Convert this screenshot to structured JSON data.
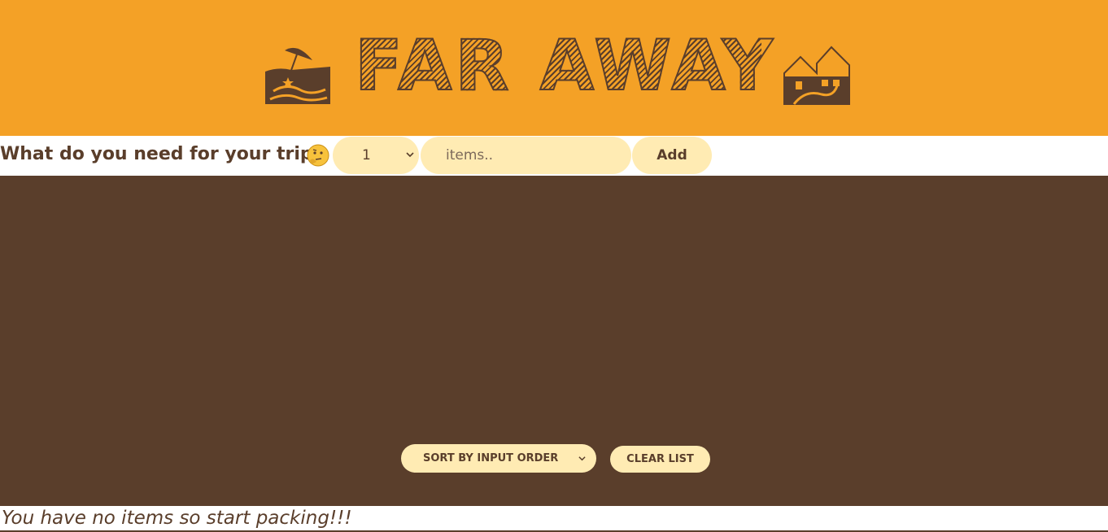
{
  "header": {
    "title": "FAR AWAY",
    "left_icon": "beach-umbrella-icon",
    "right_icon": "houses-icon",
    "bg_color": "#f4a126",
    "ink_color": "#5a3e2b"
  },
  "add_form": {
    "question": "What do you need for your trip?",
    "question_icon": "thinking-face-icon",
    "quantity": "1",
    "item_placeholder": "items..",
    "add_label": "Add"
  },
  "list": {
    "bg_color": "#5a3e2b",
    "sort_value": "SORT BY INPUT ORDER",
    "clear_label": "CLEAR LIST"
  },
  "footer": {
    "stats_text": "You have no items so start packing!!!"
  },
  "accent_color": "#ffebb3"
}
